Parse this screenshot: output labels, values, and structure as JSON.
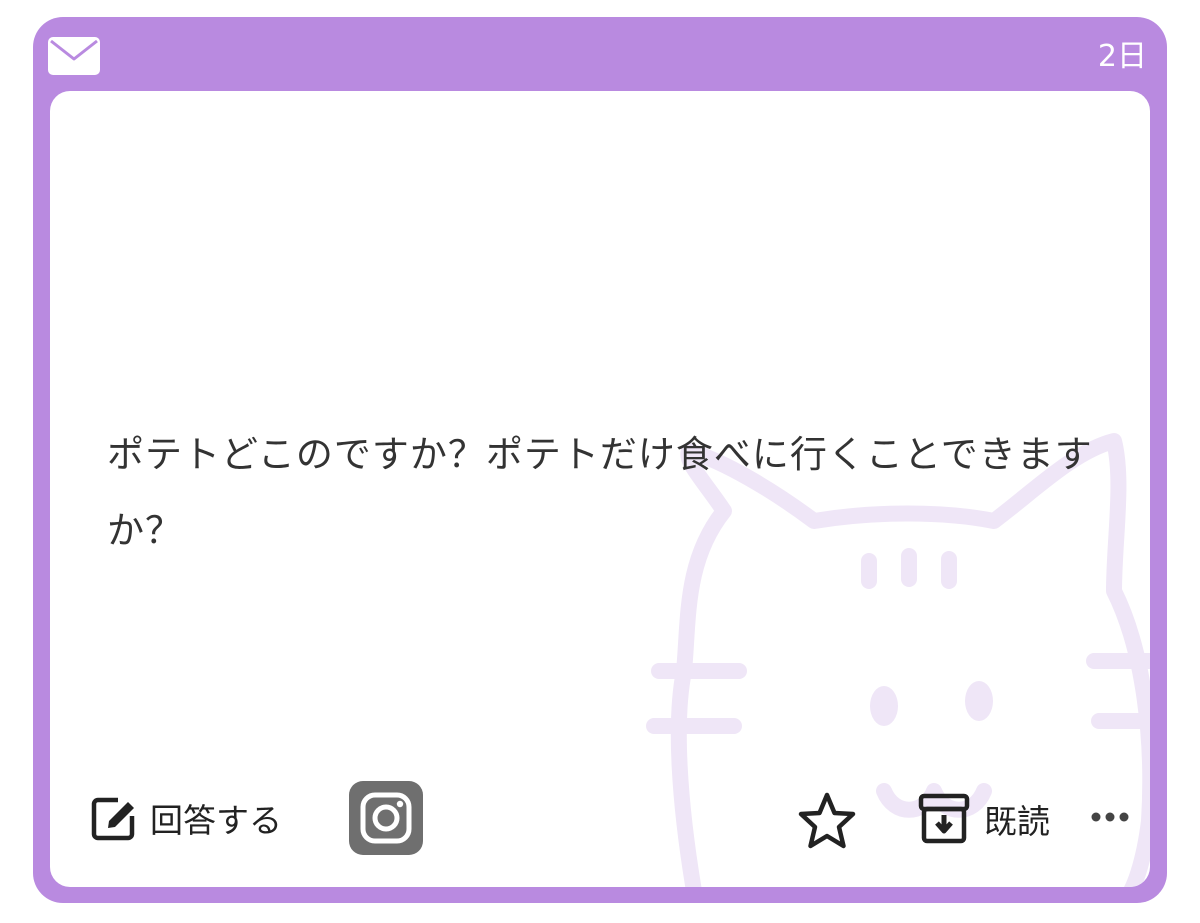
{
  "header": {
    "age": "2日",
    "mail_icon": "mail-icon"
  },
  "message": {
    "text": "ポテトどこのですか？ポテトだけ食べに行くことできますか？"
  },
  "actions": {
    "reply_label": "回答する",
    "reply_icon": "edit-icon",
    "instagram_icon": "instagram-icon",
    "star_icon": "star-icon",
    "archive_label": "既読",
    "archive_icon": "archive-icon",
    "more_icon": "more-icon"
  },
  "colors": {
    "accent": "#b98ae0",
    "watermark": "#efe6f7",
    "text": "#333333"
  }
}
